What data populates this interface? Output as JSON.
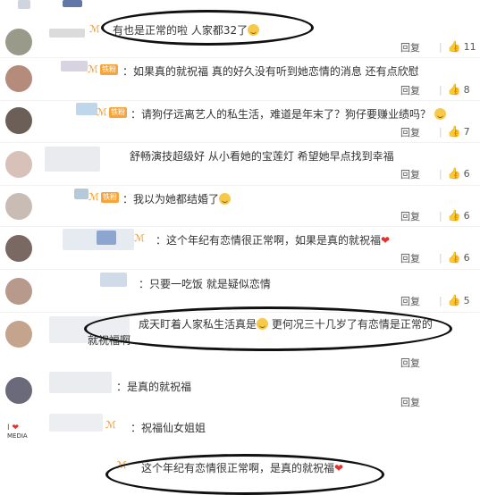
{
  "comments": [
    {
      "text": "有也是正常的啦 人家都32了",
      "reply": "回复",
      "likes": "11"
    },
    {
      "text": "：如果真的就祝福 真的好久没有听到她恋情的消息 还有点欣慰",
      "reply": "回复",
      "likes": "8"
    },
    {
      "text": "：请狗仔远离艺人的私生活，难道是年末了？狗仔要赚业绩吗？",
      "reply": "回复",
      "likes": "7"
    },
    {
      "text": "舒畅演技超级好 从小看她的宝莲灯 希望她早点找到幸福",
      "reply": "回复",
      "likes": "6"
    },
    {
      "text": "：我以为她都结婚了",
      "reply": "回复",
      "likes": "6"
    },
    {
      "text": "：这个年纪有恋情很正常啊，如果是真的就祝福",
      "reply": "回复",
      "likes": "6"
    },
    {
      "text": "：只要一吃饭 就是疑似恋情",
      "reply": "回复",
      "likes": "5"
    },
    {
      "text": "成天盯着人家私生活真是",
      "text2": "更何况三十几岁了有恋情是正常的",
      "text3": "就祝福啊",
      "reply": "回复",
      "likes": ""
    },
    {
      "text": "：是真的就祝福",
      "reply": "回复",
      "likes": ""
    },
    {
      "text": "：祝福仙女姐姐",
      "reply": "",
      "likes": ""
    },
    {
      "text": "这个年纪有恋情很正常啊，是真的就祝福",
      "reply": "",
      "likes": ""
    }
  ],
  "badge_label": "铁粉",
  "watermark_label": "MEDIA",
  "colors": {
    "accent": "#ff8a00",
    "badge": "#f7a43a",
    "oval": "#111111",
    "heart": "#e0322e"
  }
}
